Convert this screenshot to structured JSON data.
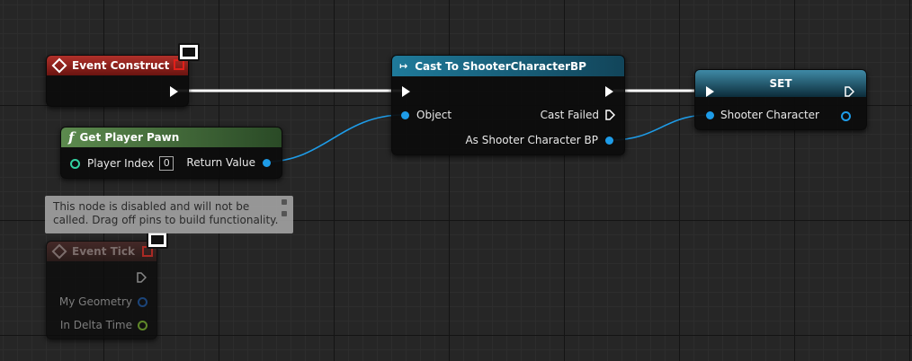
{
  "nodes": {
    "event_construct": {
      "title": "Event Construct"
    },
    "get_player_pawn": {
      "title": "Get Player Pawn",
      "function_glyph": "f",
      "input_label": "Player Index",
      "input_value": "0",
      "output_label": "Return Value"
    },
    "cast": {
      "title": "Cast To ShooterCharacterBP",
      "object_label": "Object",
      "cast_failed_label": "Cast Failed",
      "as_label": "As Shooter Character BP"
    },
    "set": {
      "title": "SET",
      "input_label": "Shooter Character"
    },
    "event_tick": {
      "title": "Event Tick",
      "geometry_label": "My Geometry",
      "delta_label": "In Delta Time"
    }
  },
  "tooltip": {
    "text": "This node is disabled and will not be called. Drag off pins to build functionality."
  },
  "colors": {
    "exec": "#ffffff",
    "object_pin": "#1e9ce8",
    "event_header": "#8e1e1a",
    "function_header": "#3e6a36",
    "cast_header": "#16566e",
    "set_header": "#1c5c70",
    "int_pin": "#33d1a0",
    "float_pin": "#8ec33b"
  }
}
